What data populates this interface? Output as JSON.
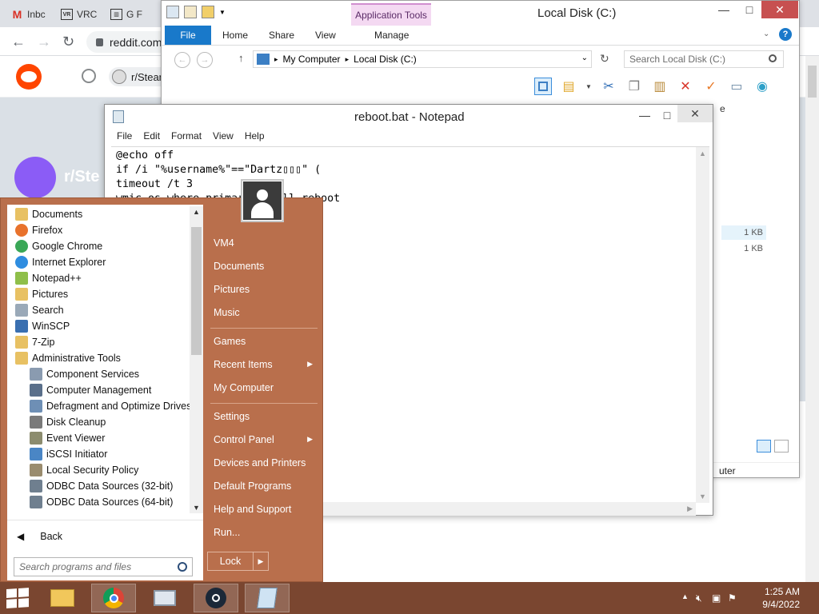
{
  "browser": {
    "tabs": [
      {
        "icon": "gmail-icon",
        "label": "Inbc"
      },
      {
        "icon": "vr-icon",
        "label": "VRC"
      },
      {
        "icon": "bank-icon",
        "label": "G F"
      }
    ],
    "tab_icon_texts": {
      "vr": "VR",
      "bank": "▥"
    },
    "url": "reddit.com",
    "reddit_chip": "r/Stean",
    "subreddit_name": "r/Ste"
  },
  "explorer": {
    "title": "Local Disk (C:)",
    "app_tools_label": "Application Tools",
    "ribbon_tabs": [
      "File",
      "Home",
      "Share",
      "View",
      "Manage"
    ],
    "breadcrumb": [
      "My Computer",
      "Local Disk (C:)"
    ],
    "search_placeholder": "Search Local Disk (C:)",
    "file_sizes": [
      "1 KB",
      "1 KB"
    ],
    "status_right": "uter",
    "partial_column_header": "e",
    "colors": {
      "app_tools_bg": "#f4d9f2",
      "file_tab": "#1979ca"
    }
  },
  "notepad": {
    "title": "reboot.bat - Notepad",
    "menu": [
      "File",
      "Edit",
      "Format",
      "View",
      "Help"
    ],
    "text": "@echo off\nif /i \"%username%\"==\"Dartz▯▯▯\" (\ntimeout /t 3\nwmic os where primary=1 call reboot"
  },
  "start_menu": {
    "programs": [
      {
        "label": "Documents",
        "icon": "folder-icon",
        "sub": false,
        "color": "#e8c163"
      },
      {
        "label": "Firefox",
        "icon": "firefox-icon",
        "sub": false,
        "color": "#e8722c"
      },
      {
        "label": "Google Chrome",
        "icon": "chrome-icon",
        "sub": false,
        "color": "#3aa757"
      },
      {
        "label": "Internet Explorer",
        "icon": "ie-icon",
        "sub": false,
        "color": "#2f8de0"
      },
      {
        "label": "Notepad++",
        "icon": "notepadpp-icon",
        "sub": false,
        "color": "#8fbf4a"
      },
      {
        "label": "Pictures",
        "icon": "folder-icon",
        "sub": false,
        "color": "#e8c163"
      },
      {
        "label": "Search",
        "icon": "search-icon",
        "sub": false,
        "color": "#9aa9b8"
      },
      {
        "label": "WinSCP",
        "icon": "winscp-icon",
        "sub": false,
        "color": "#3a6fb0"
      },
      {
        "label": "7-Zip",
        "icon": "folder-icon",
        "sub": false,
        "color": "#e8c163"
      },
      {
        "label": "Administrative Tools",
        "icon": "folder-icon",
        "sub": false,
        "color": "#e8c163"
      },
      {
        "label": "Component Services",
        "icon": "component-services-icon",
        "sub": true,
        "color": "#8a9bb0"
      },
      {
        "label": "Computer Management",
        "icon": "computer-management-icon",
        "sub": true,
        "color": "#5a6f8a"
      },
      {
        "label": "Defragment and Optimize Drives",
        "icon": "defrag-icon",
        "sub": true,
        "color": "#6e8fb5"
      },
      {
        "label": "Disk Cleanup",
        "icon": "disk-cleanup-icon",
        "sub": true,
        "color": "#7a7a7a"
      },
      {
        "label": "Event Viewer",
        "icon": "event-viewer-icon",
        "sub": true,
        "color": "#8c8c6e"
      },
      {
        "label": "iSCSI Initiator",
        "icon": "iscsi-icon",
        "sub": true,
        "color": "#4a86c5"
      },
      {
        "label": "Local Security Policy",
        "icon": "security-policy-icon",
        "sub": true,
        "color": "#9a8c6e"
      },
      {
        "label": "ODBC Data Sources (32-bit)",
        "icon": "odbc-icon",
        "sub": true,
        "color": "#6f7f8f"
      },
      {
        "label": "ODBC Data Sources (64-bit)",
        "icon": "odbc-icon",
        "sub": true,
        "color": "#6f7f8f"
      }
    ],
    "back_label": "Back",
    "search_placeholder": "Search programs and files",
    "right_links": [
      {
        "label": "VM4",
        "arrow": false
      },
      {
        "label": "Documents",
        "arrow": false
      },
      {
        "label": "Pictures",
        "arrow": false
      },
      {
        "label": "Music",
        "arrow": false
      },
      {
        "label": "Games",
        "arrow": false
      },
      {
        "label": "Recent Items",
        "arrow": true
      },
      {
        "label": "My Computer",
        "arrow": false
      },
      {
        "label": "Settings",
        "arrow": false
      },
      {
        "label": "Control Panel",
        "arrow": true
      },
      {
        "label": "Devices and Printers",
        "arrow": false
      },
      {
        "label": "Default Programs",
        "arrow": false
      },
      {
        "label": "Help and Support",
        "arrow": false
      },
      {
        "label": "Run...",
        "arrow": false
      }
    ],
    "lock_label": "Lock",
    "colors": {
      "panel": "#b96f4c",
      "taskbar": "#7a4630"
    }
  },
  "taskbar": {
    "pinned": [
      {
        "name": "file-explorer-taskbar-button",
        "icon": "folder-icon",
        "active": false
      },
      {
        "name": "chrome-taskbar-button",
        "icon": "chrome-icon",
        "active": true
      },
      {
        "name": "task-manager-taskbar-button",
        "icon": "monitor-icon",
        "active": false
      },
      {
        "name": "steam-taskbar-button",
        "icon": "steam-icon",
        "active": true
      },
      {
        "name": "notepad-taskbar-button",
        "icon": "notepad-icon",
        "active": true
      }
    ],
    "time": "1:25 AM",
    "date": "9/4/2022"
  }
}
